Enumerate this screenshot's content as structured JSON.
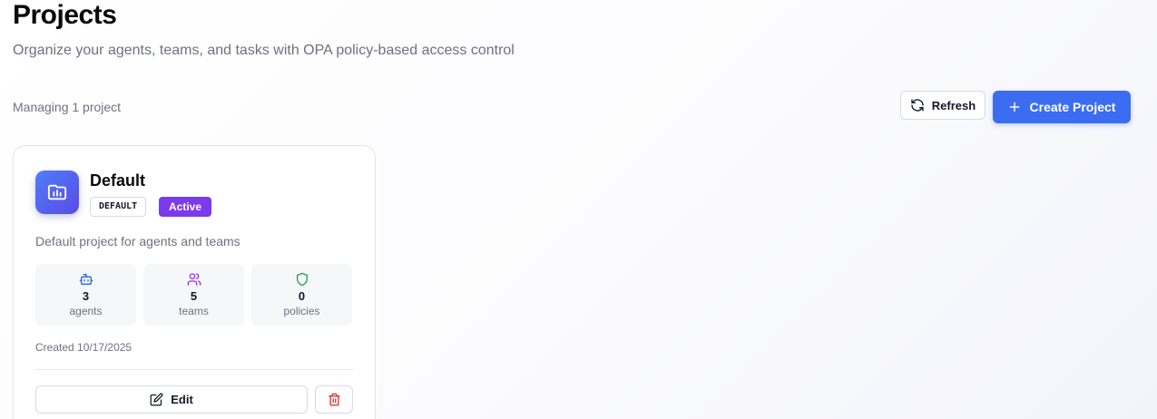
{
  "header": {
    "title": "Projects",
    "subtitle": "Organize your agents, teams, and tasks with OPA policy-based access control"
  },
  "toolbar": {
    "summary": "Managing 1 project",
    "refresh_label": "Refresh",
    "refresh_icon": "refresh-icon",
    "create_label": "Create Project",
    "create_icon": "plus-icon"
  },
  "projects": [
    {
      "icon": "folder-chart-icon",
      "name": "Default",
      "tag": "DEFAULT",
      "status": "Active",
      "description": "Default project for agents and teams",
      "stats": [
        {
          "icon": "bot-icon",
          "value": "3",
          "label": "agents",
          "color": "#2563eb"
        },
        {
          "icon": "users-icon",
          "value": "5",
          "label": "teams",
          "color": "#9333ea"
        },
        {
          "icon": "shield-icon",
          "value": "0",
          "label": "policies",
          "color": "#16a34a"
        }
      ],
      "created": "Created 10/17/2025",
      "edit_label": "Edit",
      "edit_icon": "edit-icon",
      "delete_icon": "trash-icon"
    }
  ],
  "colors": {
    "primary": "#3b6cf2",
    "active_badge": "#7c3aed",
    "danger": "#dc2626"
  }
}
